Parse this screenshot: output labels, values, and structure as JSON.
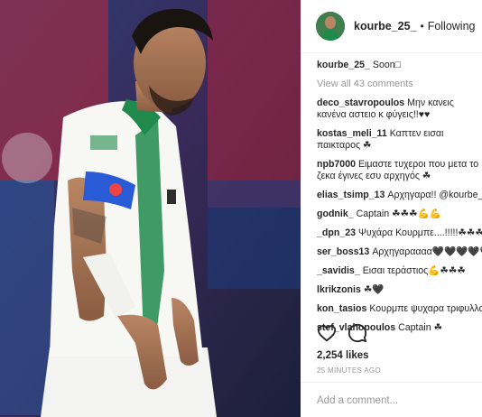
{
  "post": {
    "username": "kourbe_25_",
    "dot": "•",
    "follow_state": "Following",
    "caption": "Soon⁠□",
    "view_all": "View all 43 comments",
    "likes": "2,254 likes",
    "time": "25 MINUTES AGO",
    "add_comment_placeholder": "Add a comment..."
  },
  "comments": [
    {
      "user": "deco_stavropoulos",
      "text": "Μην κανεις κανένα αστειο κ φύγεις!!♥♥"
    },
    {
      "user": "kostas_meli_11",
      "text": "Καπτεν εισαι παικταρος ☘"
    },
    {
      "user": "npb7000",
      "text": "Ειμαστε τυχεροι που μετα το ζεκα έγινες εσυ αρχηγός ☘"
    },
    {
      "user": "elias_tsimp_13",
      "text": "Αρχηγαρα!! @kourbe_25_"
    },
    {
      "user": "godnik_",
      "text": "Captain ☘☘☘💪💪"
    },
    {
      "user": "_dpn_23",
      "text": "Ψυχάρα Κουρμπε....!!!!!☘☘☘☘☘"
    },
    {
      "user": "ser_boss13",
      "text": "Αρχηγαραααα🖤🖤🖤🖤🖤"
    },
    {
      "user": "_savidis_",
      "text": "Εισαι τεράστιος💪☘☘☘"
    },
    {
      "user": "lkrikzonis",
      "text": "☘🖤"
    },
    {
      "user": "kon_tasios",
      "text": "Κουρμπε ψυχαρα τριφυλλαρα"
    },
    {
      "user": "stef_vlahopoulos",
      "text": "Captain ☘"
    }
  ],
  "icons": [
    "heart-icon",
    "comment-icon"
  ],
  "colors": {
    "jersey_green": "#1f8a4c",
    "link": "#003569",
    "muted": "#999999"
  }
}
